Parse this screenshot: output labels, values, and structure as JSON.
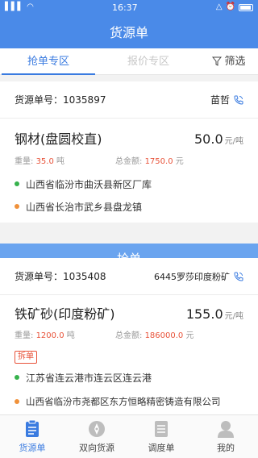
{
  "status_bar": {
    "time": "16:37",
    "signal": "▌▌▌",
    "wifi": "◠",
    "alarm": "⏰",
    "mute": "△"
  },
  "header": {
    "title": "货源单"
  },
  "tabs": [
    {
      "label": "抢单专区",
      "active": true
    },
    {
      "label": "报价专区",
      "active": false
    },
    {
      "label": "筛选",
      "active": false,
      "icon": "filter-icon"
    }
  ],
  "cards": [
    {
      "order_label": "货源单号：",
      "order_no": "1035897",
      "contact": "苗哲",
      "goods": "钢材(盘圆校直)",
      "price": "50.0",
      "price_unit": "元/吨",
      "weight_label": "重量:",
      "weight": "35.0",
      "weight_unit": "吨",
      "total_label": "总金额:",
      "total": "1750.0",
      "total_unit": "元",
      "from": "山西省临汾市曲沃县新区厂库",
      "to": "山西省长治市武乡县盘龙镇"
    },
    {
      "order_label": "货源单号：",
      "order_no": "1035408",
      "contact": "6445罗莎印度粉矿",
      "goods": "铁矿砂(印度粉矿)",
      "price": "155.0",
      "price_unit": "元/吨",
      "weight_label": "重量:",
      "weight": "1200.0",
      "weight_unit": "吨",
      "total_label": "总金额:",
      "total": "186000.0",
      "total_unit": "元",
      "tag": "拆单",
      "from": "江苏省连云港市连云区连云港",
      "to": "山西省临汾市尧都区东方恒略精密铸造有限公司"
    }
  ],
  "grab_button": "抢单",
  "bottom_nav": [
    {
      "label": "货源单",
      "icon": "document-icon",
      "active": true
    },
    {
      "label": "双向货源",
      "icon": "compass-icon",
      "active": false
    },
    {
      "label": "调度单",
      "icon": "list-icon",
      "active": false
    },
    {
      "label": "我的",
      "icon": "person-icon",
      "active": false
    }
  ],
  "colors": {
    "primary": "#4a8ae8",
    "accent": "#3a7be0",
    "highlight": "#e8533a",
    "grab": "#6aa4ef"
  }
}
